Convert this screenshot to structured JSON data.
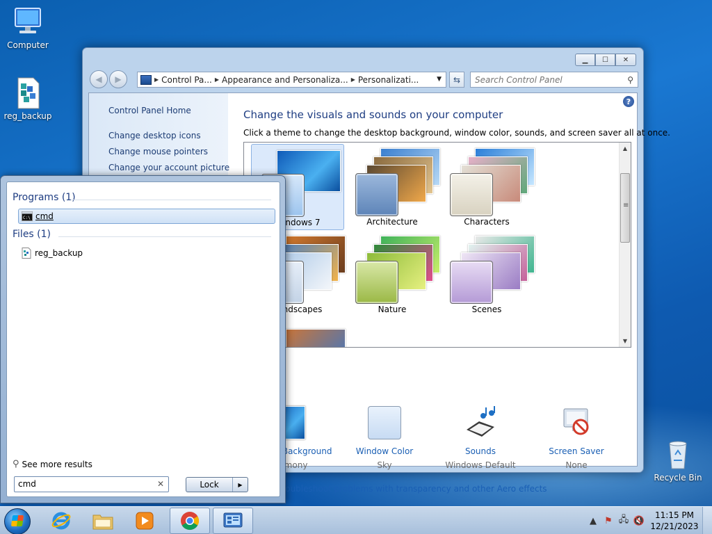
{
  "desktop": {
    "icons": [
      {
        "label": "Computer"
      },
      {
        "label": "reg_backup"
      },
      {
        "label": "Recycle Bin"
      }
    ]
  },
  "control_panel": {
    "address": {
      "crumbs": [
        "Control Pa...",
        "Appearance and Personaliza...",
        "Personalizati..."
      ]
    },
    "search_placeholder": "Search Control Panel",
    "left_links": [
      "Control Panel Home",
      "Change desktop icons",
      "Change mouse pointers",
      "Change your account picture"
    ],
    "title": "Change the visuals and sounds on your computer",
    "subtitle": "Click a theme to change the desktop background, window color, sounds, and screen saver all at once.",
    "themes": [
      {
        "label": "Windows 7",
        "selected": true
      },
      {
        "label": "Architecture",
        "selected": false
      },
      {
        "label": "Characters",
        "selected": false
      },
      {
        "label": "Landscapes",
        "selected": false
      },
      {
        "label": "Nature",
        "selected": false
      },
      {
        "label": "Scenes",
        "selected": false
      }
    ],
    "bottom_items": [
      {
        "title": "Desktop Background",
        "value": "Harmony"
      },
      {
        "title": "Window Color",
        "value": "Sky"
      },
      {
        "title": "Sounds",
        "value": "Windows Default"
      },
      {
        "title": "Screen Saver",
        "value": "None"
      }
    ],
    "aero_link": "Troubleshoot problems with transparency and other Aero effects"
  },
  "start_menu": {
    "programs_heading": "Programs (1)",
    "programs": [
      {
        "label": "cmd"
      }
    ],
    "files_heading": "Files (1)",
    "files": [
      {
        "label": "reg_backup"
      }
    ],
    "see_more": "See more results",
    "search_value": "cmd",
    "lock_label": "Lock"
  },
  "taskbar": {
    "time": "11:15 PM",
    "date": "12/21/2023"
  },
  "colors": {
    "link_blue": "#1a5fb4",
    "title_blue": "#1e3d82",
    "desktop_blue": "#1a78d2"
  }
}
